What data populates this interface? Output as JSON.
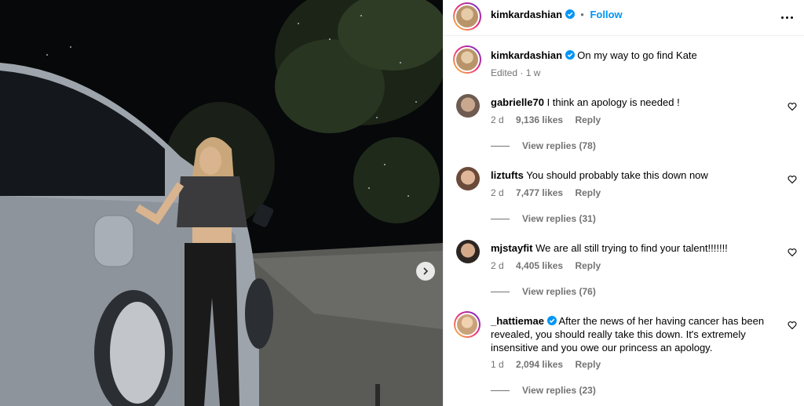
{
  "post": {
    "username": "kimkardashian",
    "follow_label": "Follow",
    "caption": "On my way to go find Kate",
    "caption_meta": "Edited · 1 w"
  },
  "colors": {
    "link_blue": "#0095f6",
    "verified_blue": "#0095f6",
    "meta_gray": "#737373"
  },
  "comments": [
    {
      "username": "gabrielle70",
      "verified": false,
      "text": "I think an apology is needed !",
      "age": "2 d",
      "likes": "9,136 likes",
      "reply": "Reply",
      "view_replies": "View replies (78)"
    },
    {
      "username": "liztufts",
      "verified": false,
      "text": "You should probably take this down now",
      "age": "2 d",
      "likes": "7,477 likes",
      "reply": "Reply",
      "view_replies": "View replies (31)"
    },
    {
      "username": "mjstayfit",
      "verified": false,
      "text": "We are all still trying to find your talent!!!!!!!",
      "age": "2 d",
      "likes": "4,405 likes",
      "reply": "Reply",
      "view_replies": "View replies (76)"
    },
    {
      "username": "_hattiemae",
      "verified": true,
      "text": "After the news of her having cancer has been revealed, you should really take this down. It's extremely insensitive and you owe our princess an apology.",
      "age": "1 d",
      "likes": "2,094 likes",
      "reply": "Reply",
      "view_replies": "View replies (23)"
    }
  ],
  "icons": {
    "next": "chevron-right-icon",
    "more": "more-options-icon",
    "like": "heart-icon",
    "verified": "verified-badge-icon"
  }
}
